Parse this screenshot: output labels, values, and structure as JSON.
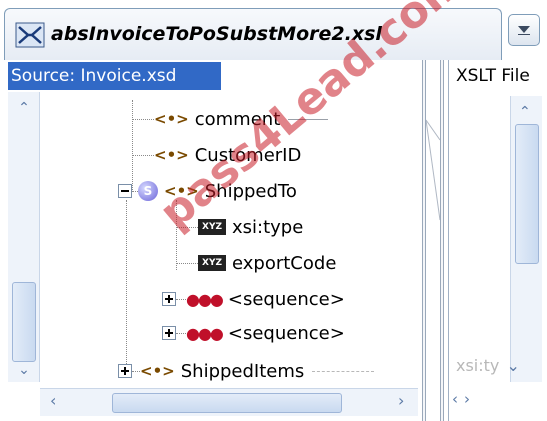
{
  "tab": {
    "title": "absInvoiceToPoSubstMore2.xsl",
    "icon": "xsl-mapping-icon",
    "dropdown_icon": "chevron-down-icon"
  },
  "source_pane": {
    "header": "Source: Invoice.xsd",
    "tree": [
      {
        "label": "comment",
        "icon": "element-icon"
      },
      {
        "label": "CustomerID",
        "icon": "element-icon"
      },
      {
        "label": "ShippedTo",
        "icon": "element-icon",
        "expanded": true,
        "badge": "S"
      },
      {
        "label": "xsi:type",
        "icon": "xyz-attribute-icon",
        "icon_text": "XYZ"
      },
      {
        "label": "exportCode",
        "icon": "xyz-attribute-icon",
        "icon_text": "XYZ"
      },
      {
        "label": "<sequence>",
        "icon": "sequence-icon"
      },
      {
        "label": "<sequence>",
        "icon": "sequence-icon"
      },
      {
        "label": "ShippedItems",
        "icon": "element-icon"
      }
    ],
    "element_icon_text": "<•>"
  },
  "target_pane": {
    "header": "XSLT File",
    "partial_item": "xsi:ty"
  },
  "watermark": "pass4Lead.com",
  "colors": {
    "header_bg": "#3169c6",
    "watermark": "#c81e28",
    "sequence_icon": "#c0102a",
    "element_icon": "#7a4a00"
  }
}
